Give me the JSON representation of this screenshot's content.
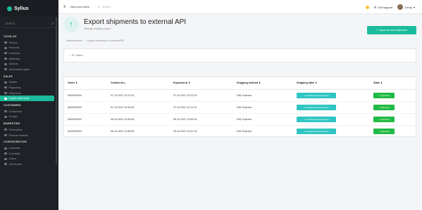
{
  "brand": {
    "name": "Sylius"
  },
  "sidebar": {
    "search_placeholder": "Search",
    "sections": [
      {
        "title": "CATALOG",
        "items": [
          "Taxons",
          "Products",
          "Inventory",
          "Attributes",
          "Options",
          "Association types"
        ]
      },
      {
        "title": "SALES",
        "items": [
          "Orders",
          "Payments",
          "Shipments",
          "Export shipments"
        ]
      },
      {
        "title": "CUSTOMERS",
        "items": [
          "Customers",
          "Groups"
        ]
      },
      {
        "title": "MARKETING",
        "items": [
          "Promotions",
          "Product reviews"
        ]
      },
      {
        "title": "CONFIGURATION",
        "items": [
          "Channels",
          "Countries",
          "Zones",
          "Currencies"
        ]
      }
    ],
    "active_item": "Export shipments"
  },
  "topbar": {
    "view_store": "View your store",
    "search_placeholder": "Search",
    "support": "Get support",
    "user": "Johny"
  },
  "header": {
    "title": "Export shipments to external API",
    "subtitle": "Manage shipping export",
    "export_button": "Export all new shipments"
  },
  "breadcrumb": [
    "Administration",
    "Export shipments to external API"
  ],
  "filters": {
    "label": "Filters"
  },
  "table": {
    "columns": [
      "Order",
      "Created at",
      "Exported at",
      "Shipping method",
      "Shipping label",
      "State"
    ],
    "rows": [
      {
        "order": "#000000024",
        "created": "07-10-2021 10:37:02",
        "exported": "07-10-2021 10:22:20",
        "method": "DHL Express",
        "label": "Download shipping label",
        "state": "Exported"
      },
      {
        "order": "#000000023",
        "created": "07-10-2021 10:30:40",
        "exported": "07-10-2021 10:11:12",
        "method": "DHL Express",
        "label": "Download shipping label",
        "state": "Exported"
      },
      {
        "order": "#000000022",
        "created": "06-10-2021 13:49:40",
        "exported": "05-10-2021 13:50:34",
        "method": "DHL Express",
        "label": "Download shipping label",
        "state": "Exported"
      },
      {
        "order": "#000000023",
        "created": "06-10-2021 13:48:54",
        "exported": "05-10-2021 13:47:18",
        "method": "DHL Express",
        "label": "Download shipping label",
        "state": "Exported"
      }
    ]
  }
}
